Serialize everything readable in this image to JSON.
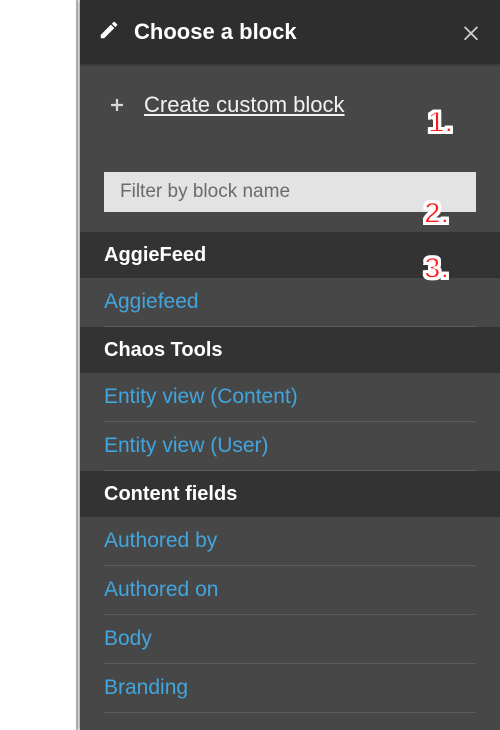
{
  "header": {
    "title": "Choose a block"
  },
  "create": {
    "label": "Create custom block"
  },
  "filter": {
    "placeholder": "Filter by block name"
  },
  "categories": [
    {
      "name": "AggieFeed",
      "blocks": [
        "Aggiefeed"
      ]
    },
    {
      "name": "Chaos Tools",
      "blocks": [
        "Entity view (Content)",
        "Entity view (User)"
      ]
    },
    {
      "name": "Content fields",
      "blocks": [
        "Authored by",
        "Authored on",
        "Body",
        "Branding"
      ]
    }
  ],
  "callouts": {
    "one": "1.",
    "two": "2.",
    "three": "3."
  }
}
